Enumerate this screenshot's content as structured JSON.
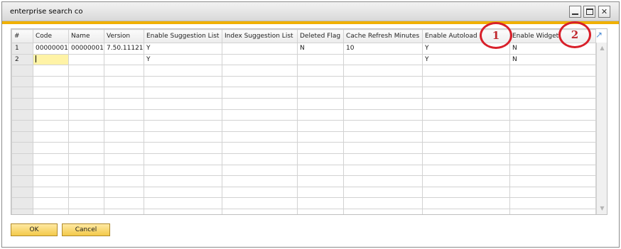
{
  "window": {
    "title": "enterprise search co"
  },
  "grid": {
    "columns": [
      {
        "label": "#"
      },
      {
        "label": "Code"
      },
      {
        "label": "Name"
      },
      {
        "label": "Version"
      },
      {
        "label": "Enable Suggestion List"
      },
      {
        "label": "Index Suggestion List"
      },
      {
        "label": "Deleted Flag"
      },
      {
        "label": "Cache Refresh Minutes"
      },
      {
        "label": "Enable Autoload"
      },
      {
        "label": "Enable Widget"
      }
    ],
    "rows": [
      {
        "num": "1",
        "code": "00000001",
        "name": "00000001",
        "version": "7.50.11121",
        "enable_suggestion": "Y",
        "index_suggestion": "",
        "deleted": "N",
        "cache_refresh": "10",
        "autoload": "Y",
        "widget": "N"
      },
      {
        "num": "2",
        "code": "",
        "name": "",
        "version": "",
        "enable_suggestion": "Y",
        "index_suggestion": "",
        "deleted": "",
        "cache_refresh": "",
        "autoload": "Y",
        "widget": "N"
      }
    ],
    "empty_row_count": 14
  },
  "annotations": {
    "marker_1": "1",
    "marker_2": "2",
    "color": "#d8202a"
  },
  "buttons": {
    "ok": "OK",
    "cancel": "Cancel"
  },
  "colors": {
    "accent": "#f0b000",
    "button": "#f3c94a",
    "active_cell": "#fff3a6"
  },
  "icons": {
    "expand": "expand-arrow-icon",
    "minimize": "minimize-icon",
    "maximize": "maximize-icon",
    "close": "close-icon"
  }
}
